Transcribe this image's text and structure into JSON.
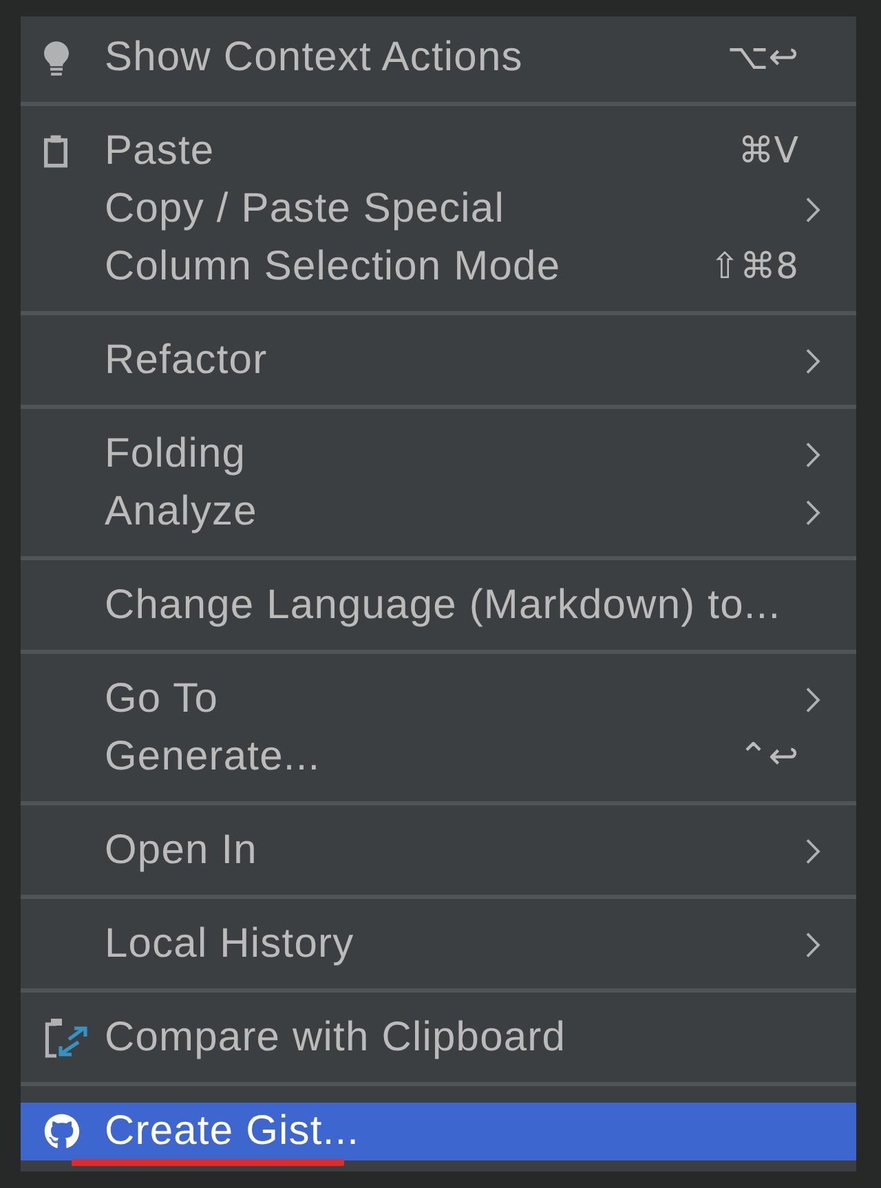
{
  "menu": {
    "groups": [
      {
        "items": [
          {
            "label": "Show Context Actions",
            "shortcut": "⌥↩",
            "submenu": false,
            "selected": false,
            "underlined": false
          }
        ]
      },
      {
        "items": [
          {
            "label": "Paste",
            "shortcut": "⌘V",
            "submenu": false,
            "selected": false,
            "underlined": false
          },
          {
            "label": "Copy / Paste Special",
            "submenu": true,
            "selected": false,
            "underlined": false
          },
          {
            "label": "Column Selection Mode",
            "shortcut": "⇧⌘8",
            "submenu": false,
            "selected": false,
            "underlined": false
          }
        ]
      },
      {
        "items": [
          {
            "label": "Refactor",
            "submenu": true,
            "selected": false,
            "underlined": false
          }
        ]
      },
      {
        "items": [
          {
            "label": "Folding",
            "submenu": true,
            "selected": false,
            "underlined": false
          },
          {
            "label": "Analyze",
            "submenu": true,
            "selected": false,
            "underlined": false
          }
        ]
      },
      {
        "items": [
          {
            "label": "Change Language (Markdown) to...",
            "submenu": false,
            "selected": false,
            "underlined": false
          }
        ]
      },
      {
        "items": [
          {
            "label": "Go To",
            "submenu": true,
            "selected": false,
            "underlined": false
          },
          {
            "label": "Generate...",
            "shortcut": "⌃↩",
            "submenu": false,
            "selected": false,
            "underlined": false
          }
        ]
      },
      {
        "items": [
          {
            "label": "Open In",
            "submenu": true,
            "selected": false,
            "underlined": false
          }
        ]
      },
      {
        "items": [
          {
            "label": "Local History",
            "submenu": true,
            "selected": false,
            "underlined": false
          }
        ]
      },
      {
        "items": [
          {
            "label": "Compare with Clipboard",
            "submenu": false,
            "selected": false,
            "underlined": false
          }
        ]
      },
      {
        "items": [
          {
            "label": "Create Gist...",
            "submenu": false,
            "selected": true,
            "underlined": true
          }
        ]
      }
    ]
  }
}
